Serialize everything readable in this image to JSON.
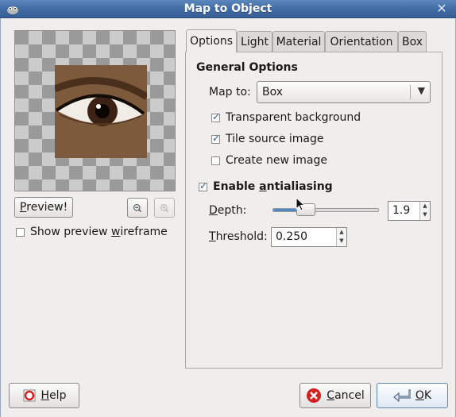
{
  "window": {
    "title": "Map to Object",
    "app_icon": "gimp-icon",
    "close_glyph": "✕"
  },
  "preview": {
    "button_label": "Preview!",
    "button_mnemonic": "P",
    "button_rest": "review!",
    "show_wireframe_label_pre": "Show preview ",
    "show_wireframe_label_mnemonic": "w",
    "show_wireframe_label_post": "ireframe",
    "show_wireframe_checked": false,
    "zoom_out_icon": "zoom-out-icon",
    "zoom_in_icon": "zoom-in-icon"
  },
  "tabs": [
    {
      "label": "Options",
      "active": true
    },
    {
      "label": "Light",
      "active": false
    },
    {
      "label": "Material",
      "active": false
    },
    {
      "label": "Orientation",
      "active": false
    },
    {
      "label": "Box",
      "active": false
    }
  ],
  "general_options": {
    "title": "General Options",
    "map_to_label": "Map to:",
    "map_to_value": "Box",
    "transparent_background": {
      "label": "Transparent background",
      "checked": true
    },
    "tile_source_image": {
      "label": "Tile source image",
      "checked": true
    },
    "create_new_image": {
      "label": "Create new image",
      "checked": false
    }
  },
  "antialiasing": {
    "label_pre": "Enable ",
    "label_mnemonic": "a",
    "label_post": "ntialiasing",
    "checked": true,
    "depth_label_mnemonic": "D",
    "depth_label_rest": "epth:",
    "depth_value": "1.9",
    "depth_fraction": 0.27,
    "threshold_label_mnemonic": "T",
    "threshold_label_rest": "hreshold:",
    "threshold_value": "0.250"
  },
  "buttons": {
    "help_mnemonic": "H",
    "help_rest": "elp",
    "cancel_mnemonic": "C",
    "cancel_rest": "ancel",
    "ok_mnemonic": "O",
    "ok_rest": "K"
  },
  "colors": {
    "titlebar": "#3f6aa2",
    "accent": "#4f86c6",
    "cancel_icon": "#d42020"
  }
}
